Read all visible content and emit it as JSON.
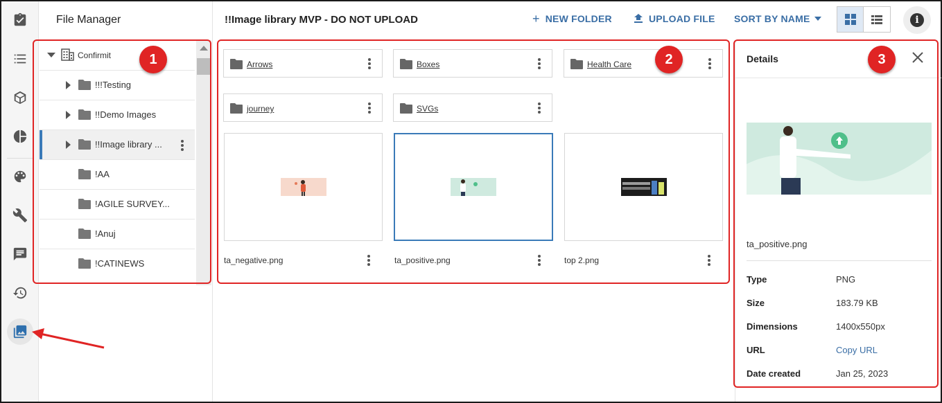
{
  "app": {
    "title": "File Manager"
  },
  "rail": {
    "items": [
      {
        "icon": "clipboard-check-icon"
      },
      {
        "icon": "list-icon"
      },
      {
        "icon": "cube-icon"
      },
      {
        "icon": "pie-chart-icon"
      },
      {
        "icon": "palette-icon"
      },
      {
        "icon": "wrench-icon"
      },
      {
        "icon": "comment-icon"
      },
      {
        "icon": "history-icon"
      },
      {
        "icon": "image-library-icon",
        "active": true
      }
    ]
  },
  "tree": {
    "root": "Confirmit",
    "items": [
      {
        "label": "!!!Testing",
        "expandable": true
      },
      {
        "label": "!!Demo Images",
        "expandable": true
      },
      {
        "label": "!!Image library ...",
        "expandable": true,
        "selected": true
      },
      {
        "label": "!AA",
        "expandable": false
      },
      {
        "label": "!AGILE SURVEY...",
        "expandable": false
      },
      {
        "label": "!Anuj",
        "expandable": false
      },
      {
        "label": "!CATINEWS",
        "expandable": false
      }
    ]
  },
  "toolbar": {
    "folder_title": "!!Image library MVP - DO NOT UPLOAD",
    "new_folder": "NEW FOLDER",
    "upload_file": "UPLOAD FILE",
    "sort_by": "SORT BY NAME"
  },
  "folders": [
    "Arrows",
    "Boxes",
    "Health Care",
    "journey",
    "SVGs"
  ],
  "files": [
    {
      "name": "ta_negative.png"
    },
    {
      "name": "ta_positive.png",
      "selected": true
    },
    {
      "name": "top 2.png"
    }
  ],
  "details": {
    "title": "Details",
    "file_name": "ta_positive.png",
    "rows": [
      {
        "key": "Type",
        "value": "PNG"
      },
      {
        "key": "Size",
        "value": "183.79 KB"
      },
      {
        "key": "Dimensions",
        "value": "1400x550px"
      },
      {
        "key": "URL",
        "value": "Copy URL"
      },
      {
        "key": "Date created",
        "value": "Jan 25, 2023"
      }
    ]
  },
  "annotations": {
    "labels": [
      "1",
      "2",
      "3"
    ],
    "color": "#e02424"
  },
  "colors": {
    "accent": "#3a6ea5",
    "selected_border": "#3a7ab8"
  }
}
